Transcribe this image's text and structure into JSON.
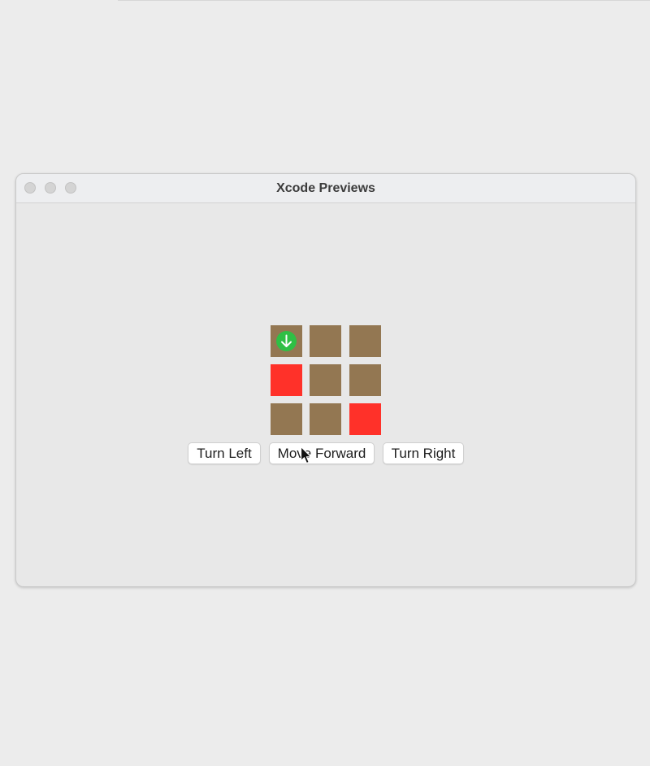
{
  "window": {
    "title": "Xcode Previews"
  },
  "grid": {
    "rows": 3,
    "cols": 3,
    "cells": [
      [
        "robot",
        "ground",
        "ground"
      ],
      [
        "red",
        "ground",
        "ground"
      ],
      [
        "ground",
        "ground",
        "red"
      ]
    ],
    "robot": {
      "row": 0,
      "col": 0,
      "direction": "down",
      "icon": "arrow-down-circle-icon"
    }
  },
  "controls": {
    "turn_left_label": "Turn Left",
    "move_forward_label": "Move Forward",
    "turn_right_label": "Turn Right"
  },
  "colors": {
    "ground": "#937752",
    "red": "#ff3129",
    "robot": "#2fbf45"
  }
}
